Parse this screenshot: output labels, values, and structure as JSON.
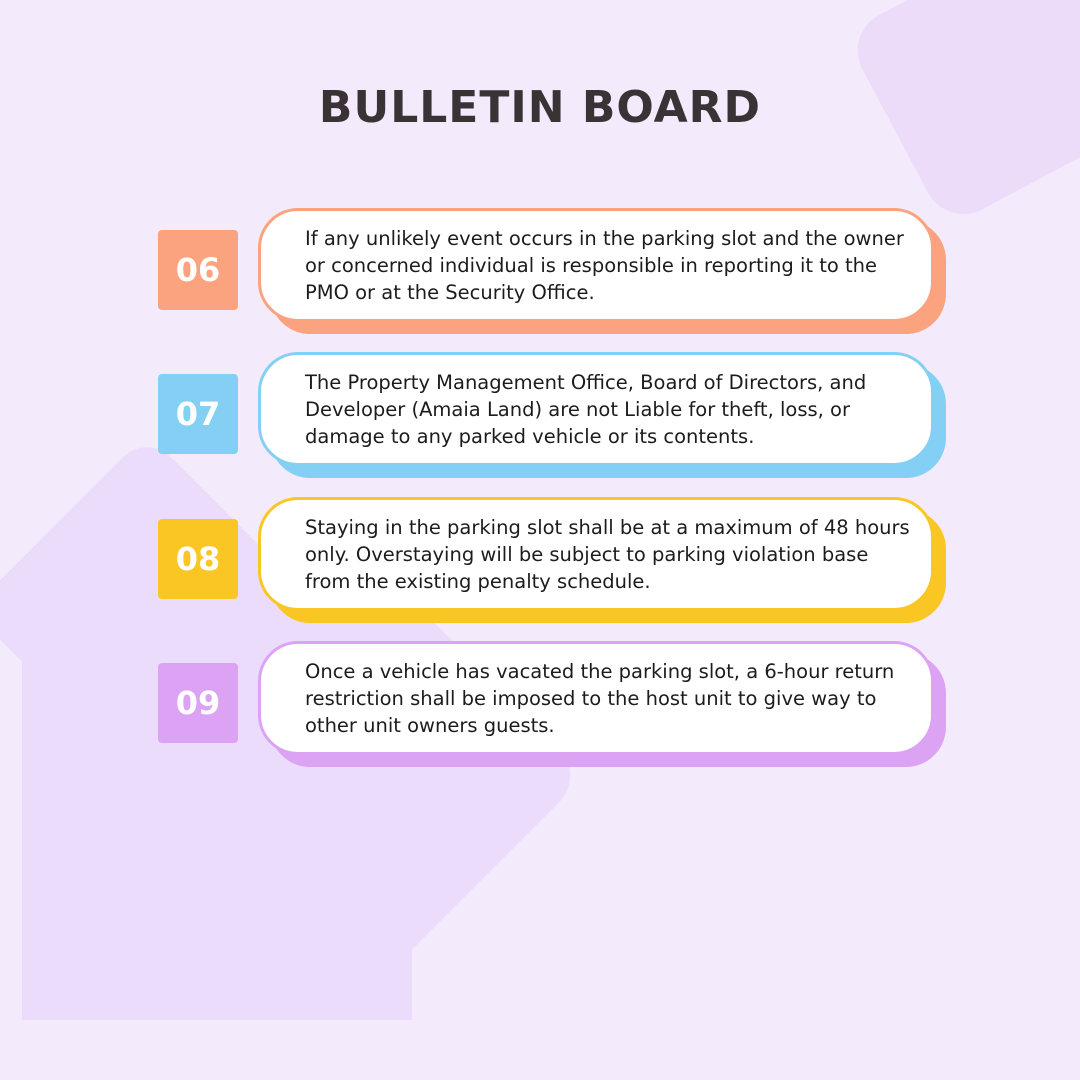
{
  "title": "BULLETIN BOARD",
  "colors": {
    "background": "#f3ebfc",
    "item_06": "#fba27e",
    "item_07": "#84d0f5",
    "item_08": "#f9c624",
    "item_09": "#dca3f5"
  },
  "items": [
    {
      "number": "06",
      "text": "If any unlikely event occurs in the parking slot and the owner or concerned individual is responsible in reporting it to the PMO or at the Security Office."
    },
    {
      "number": "07",
      "text": "The Property Management Office, Board of Directors, and Developer (Amaia Land) are not Liable for theft, loss, or damage to any parked vehicle or its contents."
    },
    {
      "number": "08",
      "text": "Staying in the parking slot shall be at a maximum of 48 hours only. Overstaying will be subject to parking violation base from the existing penalty schedule."
    },
    {
      "number": "09",
      "text": "Once a vehicle has vacated the parking slot, a 6-hour return restriction shall be imposed to the host unit to give way to other unit owners guests."
    }
  ]
}
